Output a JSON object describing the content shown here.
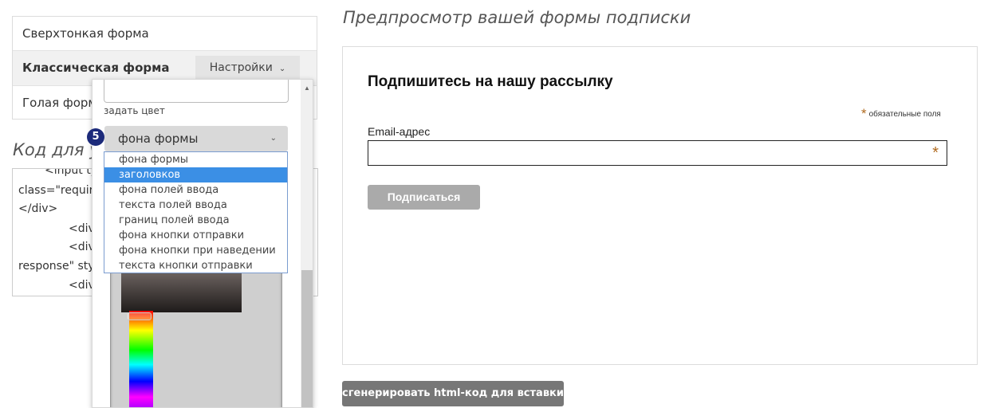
{
  "form_list": {
    "items": [
      {
        "label": "Сверхтонкая форма"
      },
      {
        "label": "Классическая форма"
      },
      {
        "label": "Голая форма"
      }
    ],
    "settings_label": "Настройки"
  },
  "code": {
    "heading": "Код для установки",
    "lines": [
      "<input ty",
      "class=\"requir",
      "</div>",
      "<div",
      "<div",
      "response\" sty",
      "<div"
    ]
  },
  "popup": {
    "set_color_label": "задать цвет",
    "step_badge": "5",
    "selected_value": "фона формы",
    "options": [
      "фона формы",
      "заголовков",
      "фона полей ввода",
      "текста полей ввода",
      "границ полей ввода",
      "фона кнопки отправки",
      "фона кнопки при наведении",
      "текста кнопки отправки"
    ],
    "highlighted_index": 1
  },
  "preview": {
    "heading": "Предпросмотр вашей формы подписки",
    "title": "Подпишитесь на нашу рассылку",
    "required_star": "*",
    "required_note": "обязательные поля",
    "email_label": "Email-адрес",
    "email_value": "",
    "subscribe_label": "Подписаться"
  },
  "generate_label": "сгенерировать html-код для вставки",
  "colors": {
    "accent_blue": "#3b8fe5",
    "badge_navy": "#1c2a7a",
    "required_star": "#b06a1e",
    "subscribe_button": "#aaaaaa",
    "generate_button": "#777777"
  },
  "icons": {
    "settings_chevron": "chevron-down-icon",
    "select_chevron": "chevron-down-icon",
    "scroll_up": "arrow-up-icon"
  }
}
